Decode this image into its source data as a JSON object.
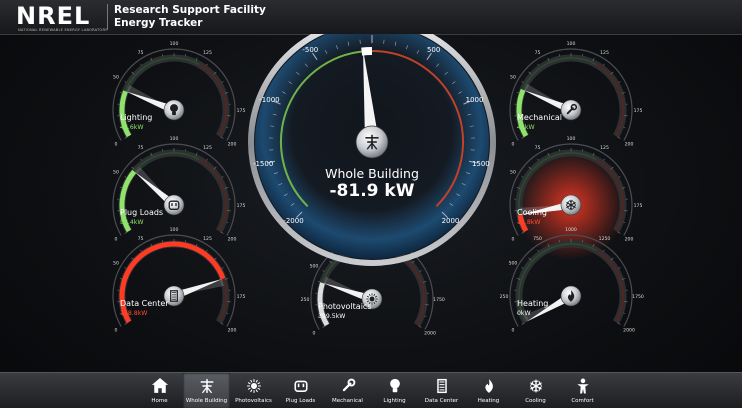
{
  "header": {
    "logo_text": "NREL",
    "logo_subtitle": "NATIONAL RENEWABLE ENERGY LABORATORY",
    "title_line1": "Research Support Facility",
    "title_line2": "Energy Tracker"
  },
  "colors": {
    "green": "#8fe36a",
    "red": "#ff3b24",
    "track": "#3a3d42",
    "whole_blue": "#1b4f77"
  },
  "gauges": [
    {
      "id": "lighting",
      "label": "Lighting",
      "value_text": "42.6kW",
      "value": 42.6,
      "max": 200,
      "ticks": [
        "0",
        "50",
        "75",
        "100",
        "125",
        "175",
        "200"
      ],
      "tick_values": [
        0,
        50,
        75,
        100,
        125,
        175,
        200
      ],
      "icon": "lightbulb-icon",
      "value_color": "#8fe36a",
      "arc_color": "#8fe36a",
      "active": false
    },
    {
      "id": "plug_loads",
      "label": "Plug Loads",
      "value_text": "58.4kW",
      "value": 58.4,
      "max": 200,
      "ticks": [
        "0",
        "50",
        "75",
        "100",
        "125",
        "175",
        "200"
      ],
      "tick_values": [
        0,
        50,
        75,
        100,
        125,
        175,
        200
      ],
      "icon": "plug-icon",
      "value_color": "#8fe36a",
      "arc_color": "#8fe36a",
      "active": false
    },
    {
      "id": "data_center",
      "label": "Data Center",
      "value_text": "158.8kW",
      "value": 158.8,
      "max": 200,
      "ticks": [
        "0",
        "50",
        "75",
        "100",
        "125",
        "175",
        "200"
      ],
      "tick_values": [
        0,
        50,
        75,
        100,
        125,
        175,
        200
      ],
      "icon": "server-icon",
      "value_color": "#ff4a30",
      "arc_color": "#ff3b24",
      "active": false
    },
    {
      "id": "photovoltaics",
      "label": "Photovoltaics",
      "value_text": "399.5kW",
      "value": 399.5,
      "max": 2000,
      "ticks": [
        "0",
        "250",
        "500",
        "750",
        "1000",
        "1250",
        "1750",
        "2000"
      ],
      "tick_values": [
        0,
        250,
        500,
        750,
        1000,
        1250,
        1750,
        2000
      ],
      "icon": "sun-icon",
      "value_color": "#ffffff",
      "arc_color": "#dddddd",
      "active": false
    },
    {
      "id": "mechanical",
      "label": "Mechanical",
      "value_text": "44kW",
      "value": 44,
      "max": 200,
      "ticks": [
        "0",
        "50",
        "75",
        "100",
        "125",
        "175",
        "200"
      ],
      "tick_values": [
        0,
        50,
        75,
        100,
        125,
        175,
        200
      ],
      "icon": "wrench-icon",
      "value_color": "#8fe36a",
      "arc_color": "#8fe36a",
      "active": false
    },
    {
      "id": "cooling",
      "label": "Cooling",
      "value_text": "15.8kW",
      "value": 15.8,
      "max": 200,
      "ticks": [
        "0",
        "50",
        "75",
        "100",
        "125",
        "175",
        "200"
      ],
      "tick_values": [
        0,
        50,
        75,
        100,
        125,
        175,
        200
      ],
      "icon": "snowflake-icon",
      "value_color": "#ff4a30",
      "arc_color": "#ff3b24",
      "active": true
    },
    {
      "id": "heating",
      "label": "Heating",
      "value_text": "0kW",
      "value": 0,
      "max": 2000,
      "ticks": [
        "0",
        "250",
        "500",
        "750",
        "1000",
        "1250",
        "1750",
        "2000"
      ],
      "tick_values": [
        0,
        250,
        500,
        750,
        1000,
        1250,
        1750,
        2000
      ],
      "icon": "flame-icon",
      "value_color": "#ffffff",
      "arc_color": "#dddddd",
      "active": false
    }
  ],
  "whole_building": {
    "label": "Whole Building",
    "value_text": "-81.9 kW",
    "value": -81.9,
    "min": -2000,
    "max": 2000,
    "ticks": [
      "-2000",
      "-1500",
      "-1000",
      "-500",
      "0",
      "500",
      "1000",
      "1500",
      "2000"
    ],
    "tick_values": [
      -2000,
      -1500,
      -1000,
      -500,
      0,
      500,
      1000,
      1500,
      2000
    ],
    "icon": "power-line-icon"
  },
  "nav": {
    "active": "Whole Building",
    "items": [
      {
        "label": "Home",
        "icon": "home-icon"
      },
      {
        "label": "Whole Building",
        "icon": "power-line-icon"
      },
      {
        "label": "Photovoltaics",
        "icon": "sun-icon"
      },
      {
        "label": "Plug Loads",
        "icon": "plug-icon"
      },
      {
        "label": "Mechanical",
        "icon": "wrench-icon"
      },
      {
        "label": "Lighting",
        "icon": "lightbulb-icon"
      },
      {
        "label": "Data Center",
        "icon": "server-icon"
      },
      {
        "label": "Heating",
        "icon": "flame-icon"
      },
      {
        "label": "Cooling",
        "icon": "snowflake-icon"
      },
      {
        "label": "Comfort",
        "icon": "person-icon"
      }
    ]
  }
}
